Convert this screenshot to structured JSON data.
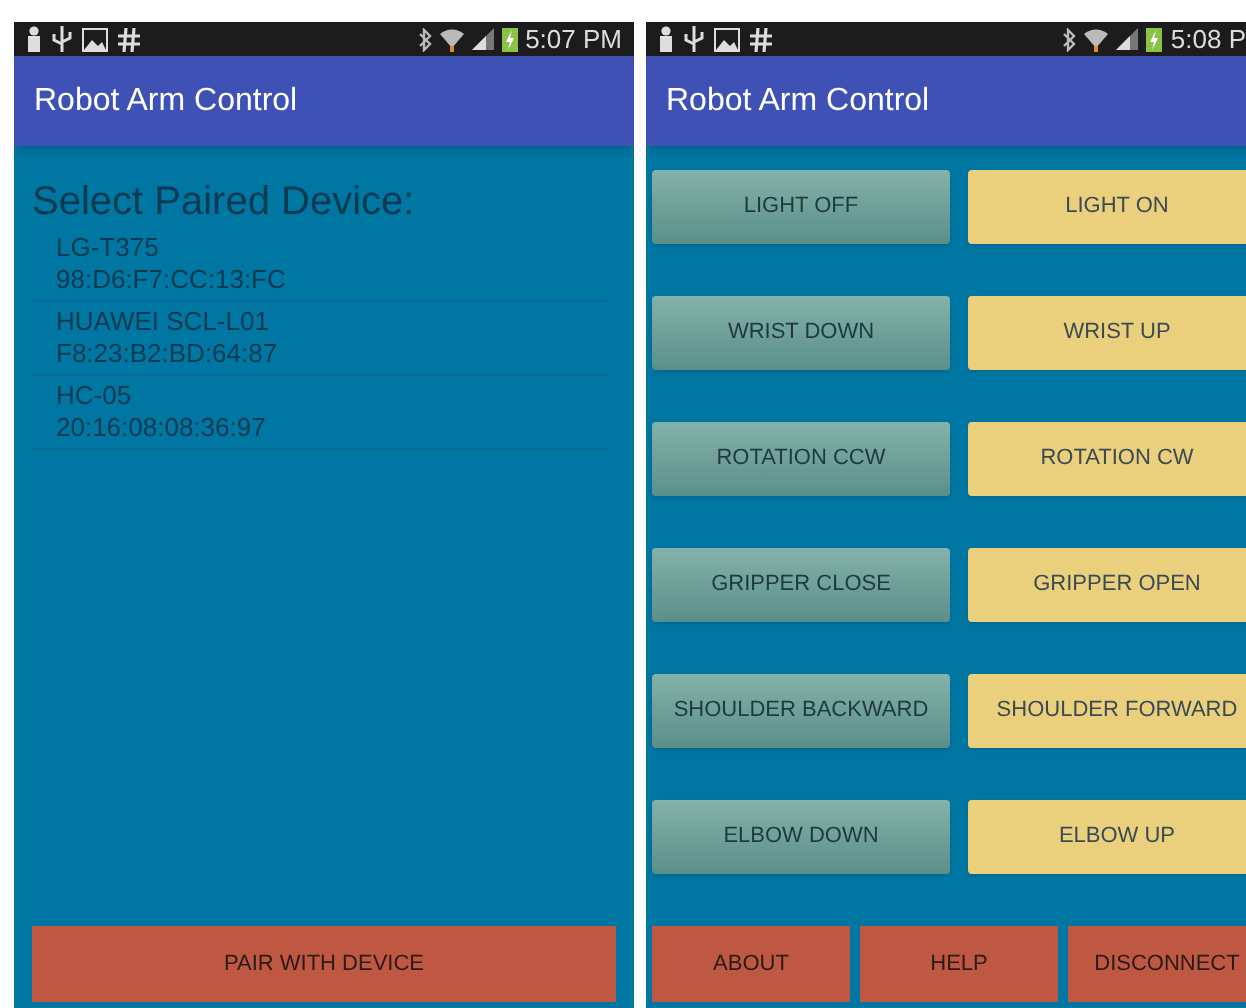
{
  "screens": [
    {
      "status_bar": {
        "time": "5:07 PM"
      },
      "app_bar": {
        "title": "Robot Arm Control"
      },
      "heading": "Select Paired Device:",
      "devices": [
        {
          "name": "LG-T375",
          "address": "98:D6:F7:CC:13:FC"
        },
        {
          "name": "HUAWEI SCL-L01",
          "address": "F8:23:B2:BD:64:87"
        },
        {
          "name": "HC-05",
          "address": "20:16:08:08:36:97"
        }
      ],
      "bottom_buttons": [
        "PAIR WITH DEVICE"
      ]
    },
    {
      "status_bar": {
        "time": "5:08 P"
      },
      "app_bar": {
        "title": "Robot Arm Control"
      },
      "control_rows": [
        {
          "left": "LIGHT OFF",
          "right": "LIGHT ON"
        },
        {
          "left": "WRIST DOWN",
          "right": "WRIST UP"
        },
        {
          "left": "ROTATION CCW",
          "right": "ROTATION CW"
        },
        {
          "left": "GRIPPER CLOSE",
          "right": "GRIPPER OPEN"
        },
        {
          "left": "SHOULDER BACKWARD",
          "right": "SHOULDER FORWARD"
        },
        {
          "left": "ELBOW DOWN",
          "right": "ELBOW UP"
        }
      ],
      "bottom_buttons": [
        "ABOUT",
        "HELP",
        "DISCONNECT"
      ]
    }
  ]
}
